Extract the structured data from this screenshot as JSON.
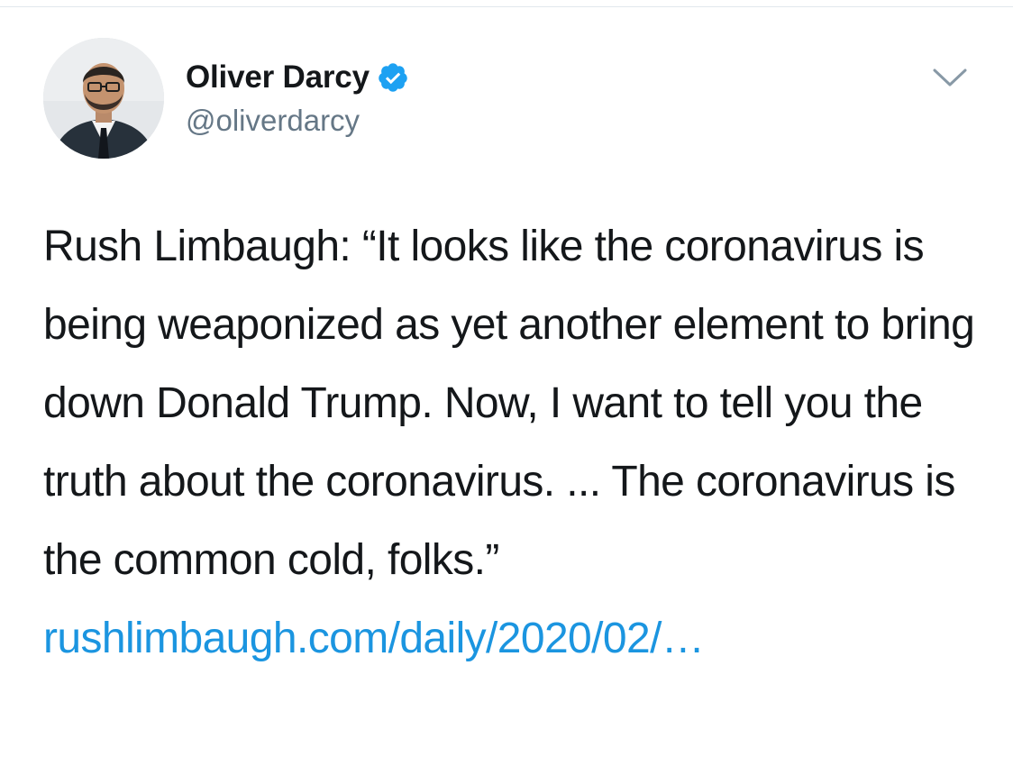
{
  "tweet": {
    "author": {
      "display_name": "Oliver Darcy",
      "handle": "@oliverdarcy",
      "verified": true,
      "avatar_icon": "profile-photo"
    },
    "menu_icon": "chevron-down-icon",
    "text": "Rush Limbaugh: “It looks like the coronavirus is being weaponized as yet another element to bring down Donald Trump. Now, I want to tell you the truth about the coronavirus. ... The coronavirus is the common cold, folks.”",
    "link": "rushlimbaugh.com/daily/2020/02/…"
  },
  "colors": {
    "text": "#14171a",
    "secondary_text": "#657786",
    "link": "#1b95e0",
    "verified": "#1da1f2",
    "divider": "#e1e8ed"
  }
}
